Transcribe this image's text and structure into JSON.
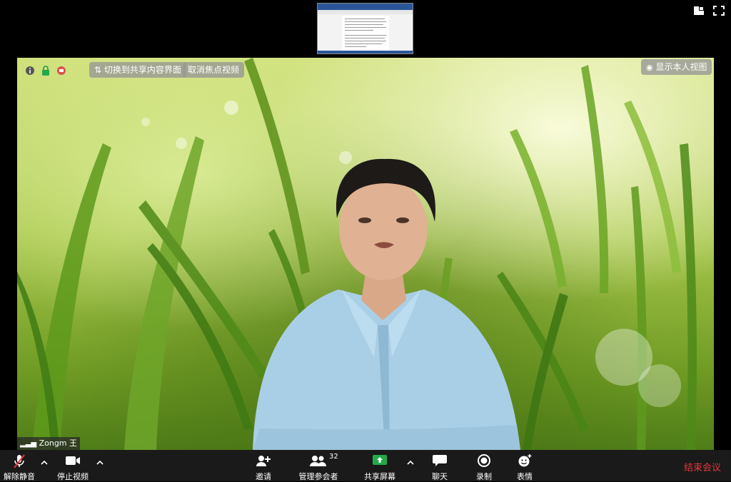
{
  "top_bar": {
    "shared_thumbnail_label": "shared-screen-preview",
    "view_icon": "gallery-view-icon",
    "fullscreen_icon": "fullscreen-icon"
  },
  "video": {
    "info_icon": "info-icon",
    "lock_icon": "lock-icon",
    "record_dot_icon": "record-indicator-icon",
    "switch_to_share_label": "切换到共享内容界面",
    "cancel_spotlight_label": "取消焦点视频",
    "show_self_view_label": "显示本人视图",
    "participant_name": "Zongm 王"
  },
  "toolbar": {
    "unmute_label": "解除静音",
    "stop_video_label": "停止视频",
    "invite_label": "邀请",
    "participants_label": "管理参会者",
    "participants_count": "32",
    "share_screen_label": "共享屏幕",
    "chat_label": "聊天",
    "record_label": "录制",
    "reactions_label": "表情",
    "end_meeting_label": "结束会议"
  },
  "colors": {
    "toolbar_bg": "#1a1a1a",
    "share_green": "#23a94b",
    "end_red": "#e0383e",
    "mute_red": "#e0383e"
  }
}
